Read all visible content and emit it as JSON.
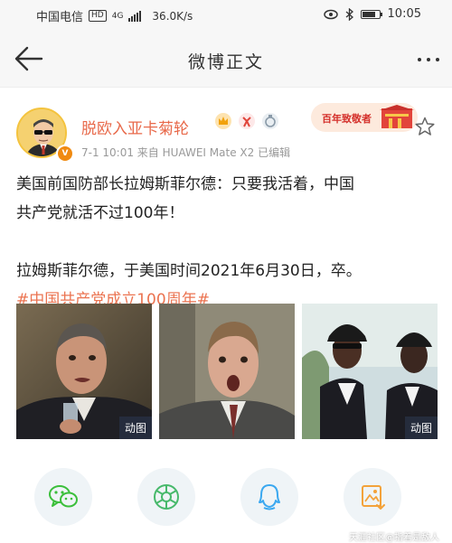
{
  "status_bar": {
    "carrier": "中国电信",
    "hd": "HD",
    "network": "4G",
    "speed": "36.0K/s",
    "time": "10:05",
    "battery_level": 0.8
  },
  "nav": {
    "title": "微博正文",
    "back_icon": "arrow-left-icon",
    "more_icon": "more-dots-icon"
  },
  "post": {
    "username": "脱欧入亚卡菊轮",
    "meta": "7-1 10:01  来自 HUAWEI Mate X2  已编辑",
    "promo": "百年致敬者",
    "lines_1": [
      "美国前国防部长拉姆斯菲尔德：只要我活着，中国",
      "共产党就活不过100年！"
    ],
    "line_2": "拉姆斯菲尔德，于美国时间2021年6月30日，卒。",
    "topic": "#中国共产党成立100周年#",
    "images": [
      {
        "tag": "动图"
      },
      {
        "tag": ""
      },
      {
        "tag": "动图"
      }
    ]
  },
  "share": {
    "items": [
      "wechat-icon",
      "moments-icon",
      "qq-icon",
      "save-image-icon"
    ]
  },
  "watermark": "天涯社区@指着是敌人",
  "colors": {
    "accent": "#eb7350",
    "username": "#e8694a",
    "share_bg": "#eff4f7",
    "wechat": "#3bbf3b",
    "moments": "#47b96b",
    "qq": "#3aa8f0",
    "save": "#f3a23a"
  }
}
